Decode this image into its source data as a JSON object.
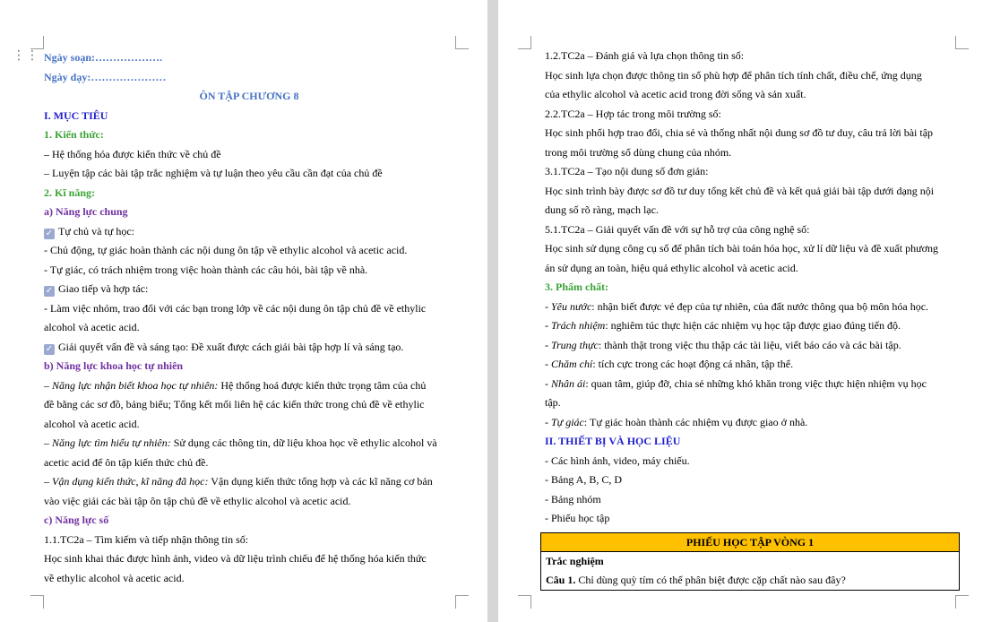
{
  "left_page": {
    "prep_date": "Ngày soạn:……………….",
    "teach_date": "Ngày dạy:…………………",
    "title": "ÔN TẬP CHƯƠNG 8",
    "section1": "I. MỤC TIÊU",
    "knowledge_heading": "1. Kiến thức:",
    "knowledge_1": "– Hệ thống hóa được kiến thức về chủ đề",
    "knowledge_2": "– Luyện tập các bài tập trắc nghiệm và tự luận theo yêu cầu cần đạt của chủ đề",
    "skills_heading": "2. Kĩ năng:",
    "general_heading": "a) Năng lực chung",
    "self_study": "Tự chủ và tự học:",
    "self_study_1": "- Chủ động, tự giác hoàn thành các nội dung ôn tập về ethylic alcohol và acetic acid.",
    "self_study_2": "- Tự giác, có trách nhiệm trong việc hoàn thành các câu hỏi, bài tập về nhà.",
    "communication": "Giao tiếp và hợp tác:",
    "communication_1a": "- Làm việc nhóm, trao đổi với các bạn trong lớp về các nội dung ôn tập chủ đề về ethylic",
    "communication_1b": "alcohol và acetic acid.",
    "problem_solving": "Giải quyết vấn đề và sáng tạo: Đề xuất được cách giải bài tập hợp lí và sáng tạo.",
    "science_heading": "b) Năng lực khoa học tự nhiên",
    "sci1_label": "– Năng lực nhận biết khoa học tự nhiên:",
    "sci1_text": " Hệ thống hoá được kiến thức trọng tâm của chủ",
    "sci1_b": "đề bằng các sơ đồ, bảng biểu; Tổng kết mối liên hệ các kiến thức trong chủ đề về ethylic",
    "sci1_c": "alcohol và acetic acid.",
    "sci2_label": "– Năng lực tìm hiểu tự nhiên:",
    "sci2_text": " Sử dụng các thông tin, dữ liệu khoa học về ethylic alcohol và",
    "sci2_b": "acetic acid để ôn tập kiến thức chủ đề.",
    "sci3_label": "– Vận dụng kiến thức, kĩ năng đã học:",
    "sci3_text": " Vận dụng kiến thức tổng hợp và các kĩ năng cơ bản",
    "sci3_b": "vào việc giải các bài tập ôn tập chủ đề về ethylic alcohol và acetic acid.",
    "digital_heading": "c) Năng lực số",
    "digital_1": " 1.1.TC2a – Tìm kiếm và tiếp nhận thông tin số:",
    "digital_1a": "Học sinh khai thác được hình ảnh, video và dữ liệu trình chiếu để hệ thống hóa kiến thức",
    "digital_1b": "về ethylic alcohol và acetic acid."
  },
  "right_page": {
    "d2": "1.2.TC2a – Đánh giá và lựa chọn thông tin số:",
    "d2a": "Học sinh lựa chọn được thông tin số phù hợp để phân tích tính chất, điều chế, ứng dụng",
    "d2b": "của ethylic alcohol và acetic acid trong đời sống và sản xuất.",
    "d3": "2.2.TC2a – Hợp tác trong môi trường số:",
    "d3a": "Học sinh phối hợp trao đổi, chia sẻ và thống nhất nội dung sơ đồ tư duy, câu trả lời bài tập",
    "d3b": "trong môi trường số dùng chung của nhóm.",
    "d4": "3.1.TC2a – Tạo nội dung số đơn giản:",
    "d4a": "Học sinh trình bày được sơ đồ tư duy tổng kết chủ đề và kết quả giải bài tập dưới dạng nội",
    "d4b": "dung số rõ ràng, mạch lạc.",
    "d5": "5.1.TC2a – Giải quyết vấn đề với sự hỗ trợ của công nghệ số:",
    "d5a": "Học sinh sử dụng công cụ số để phân tích bài toán hóa học, xử lí dữ liệu và đề xuất phương",
    "d5b": "án sử dụng an toàn, hiệu quả ethylic alcohol và acetic acid.",
    "qualities_heading": "3. Phẩm chất:",
    "q1_label": "- Yêu nước",
    "q1_text": ": nhận biết được vẻ đẹp của tự nhiên, của đất nước thông qua bộ môn hóa học.",
    "q2_label": "- Trách nhiệm",
    "q2_text": ": nghiêm túc thực hiện các nhiệm vụ học tập được giao đúng tiến độ.",
    "q3_label": "- Trung thực",
    "q3_text": ": thành thật trong việc thu thập các tài liệu, viết báo cáo và các bài tập.",
    "q4_label": "- Chăm chỉ",
    "q4_text": ": tích cực trong các hoạt động cá nhân, tập thể.",
    "q5_label": "- Nhân ái",
    "q5_text": ": quan tâm, giúp đỡ, chia sẻ những khó khăn trong việc thực hiện nhiệm vụ học",
    "q5b": "tập.",
    "q6_label": "- Tự giác",
    "q6_text": ": Tự giác hoàn thành các nhiệm vụ được giao ở nhà.",
    "section2": "II. THIẾT BỊ VÀ HỌC LIỆU",
    "m1": "- Các hình ảnh, video, máy chiếu.",
    "m2": "- Bảng A, B, C, D",
    "m3": "- Bảng nhóm",
    "m4": "- Phiếu học tập",
    "worksheet_title": "PHIẾU HỌC TẬP VÒNG 1",
    "worksheet_sub": "Trắc nghiệm",
    "question1_label": "Câu 1.",
    "question1_text": " Chỉ dùng quỳ tím có thể phân biệt được cặp chất nào sau đây?"
  },
  "colors": {
    "heading_blue": "#4472c4",
    "section_blue": "#1f1fcc",
    "green": "#3aa335",
    "purple": "#7030a0",
    "worksheet_yellow": "#ffc000"
  },
  "icons": [
    "drag-handle-icon",
    "checkbox-checked-icon"
  ]
}
